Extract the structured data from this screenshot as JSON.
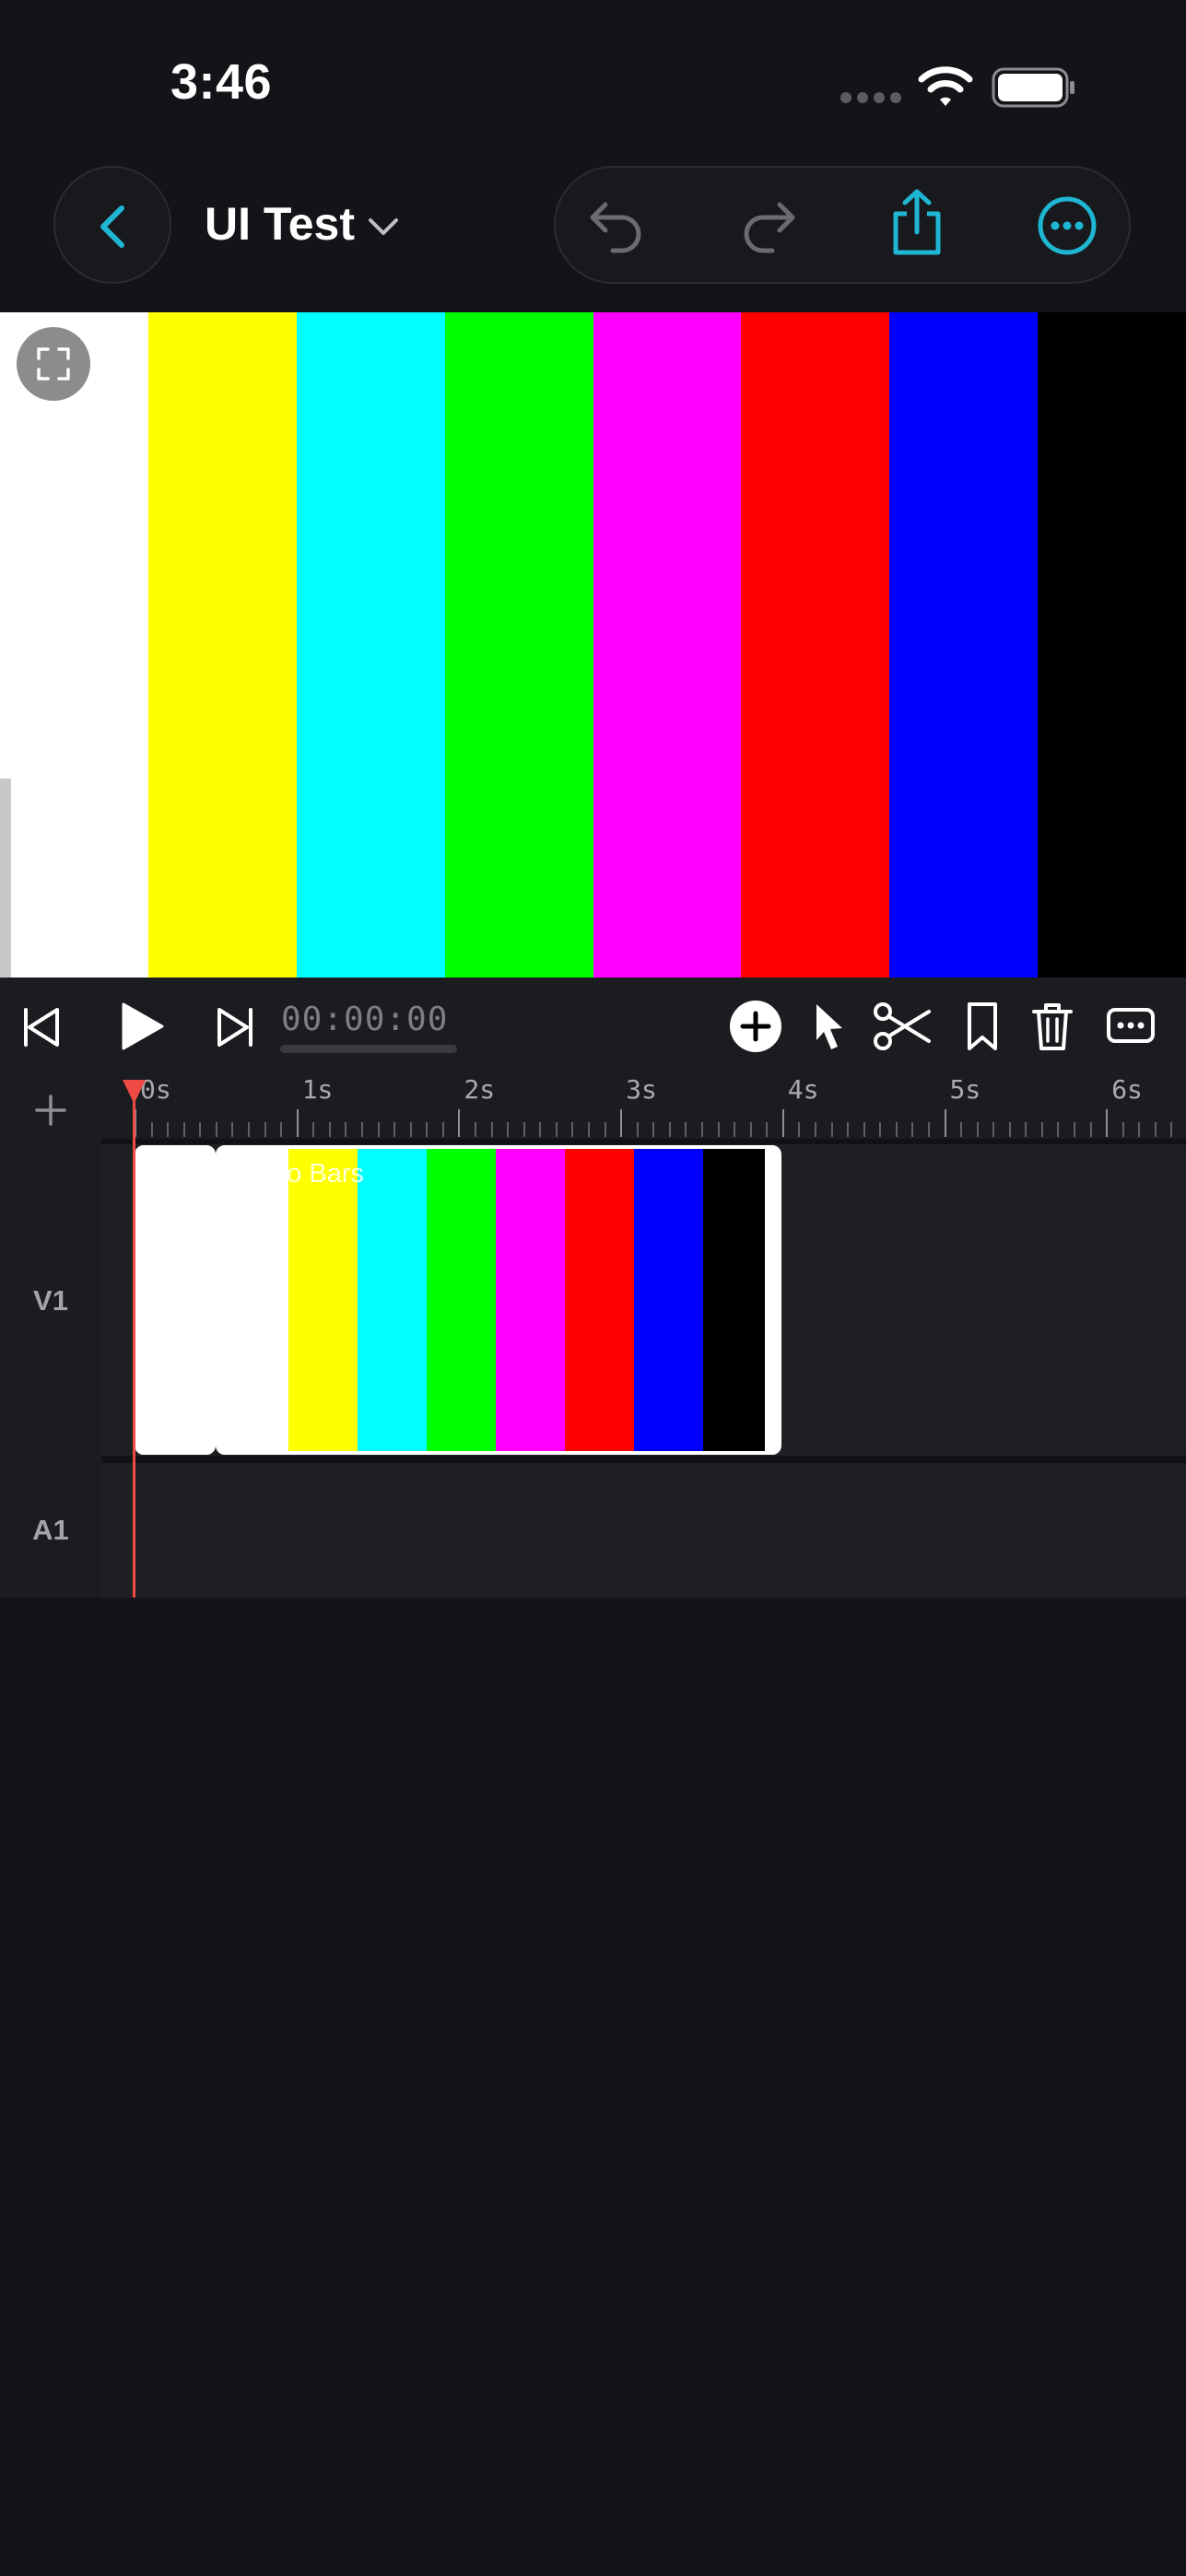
{
  "status_bar": {
    "time": "3:46"
  },
  "header": {
    "project_title": "UI Test"
  },
  "preview": {
    "color_bars": [
      "#ffffff",
      "#ffff00",
      "#00ffff",
      "#00ff00",
      "#ff00ff",
      "#ff0000",
      "#0000ff",
      "#000000"
    ]
  },
  "transport": {
    "timecode": "00:00:00"
  },
  "timeline": {
    "ruler_labels": [
      "0s",
      "1s",
      "2s",
      "3s",
      "4s",
      "5s",
      "6s"
    ],
    "tracks": {
      "video": "V1",
      "audio": "A1"
    },
    "clip": {
      "title": "Demo Bars"
    }
  },
  "colors": {
    "accent": "#1fb6d4",
    "playhead": "#ef4a44",
    "background": "#131418"
  }
}
